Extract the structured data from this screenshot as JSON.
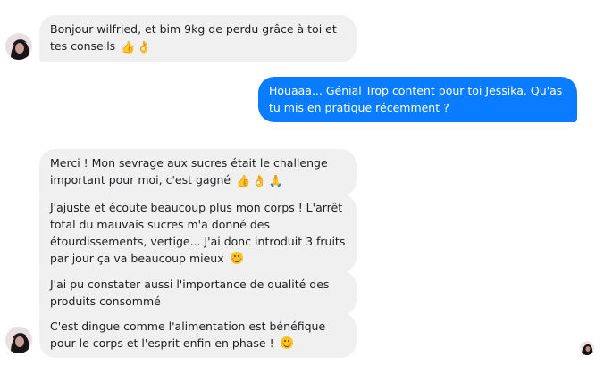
{
  "conversation": {
    "messages": [
      {
        "direction": "incoming",
        "text": "Bonjour wilfried, et bim 9kg de perdu grâce à toi et tes conseils",
        "emojis": [
          "👍",
          "👌"
        ]
      },
      {
        "direction": "outgoing",
        "text": "Houaaa... Génial Trop content pour toi Jessika. Qu'as tu mis en pratique récemment ?",
        "emojis": []
      },
      {
        "direction": "incoming",
        "text": "Merci ! Mon sevrage aux sucres était le challenge important pour moi, c'est gagné",
        "emojis": [
          "👍",
          "👌",
          "🙏"
        ]
      },
      {
        "direction": "incoming",
        "text": "J'ajuste et écoute beaucoup plus mon corps ! L'arrêt total du mauvais sucres m'a donné des étourdissements, vertige... J'ai donc introduit 3 fruits par jour ça va beaucoup mieux",
        "emojis": [
          "😊"
        ]
      },
      {
        "direction": "incoming",
        "text": "J'ai pu constater aussi l'importance de qualité des produits consommé",
        "emojis": []
      },
      {
        "direction": "incoming",
        "text": "C'est dingue comme l'alimentation est bénéfique pour le corps et l'esprit enfin en phase !",
        "emojis": [
          "😊"
        ]
      }
    ]
  },
  "colors": {
    "incoming_bubble": "#f0f0f0",
    "outgoing_bubble": "#0a7cff",
    "text_dark": "#1c1e21",
    "text_light": "#ffffff"
  },
  "icons": {
    "avatar": "contact-avatar-icon",
    "read_receipt": "seen-avatar-icon"
  }
}
